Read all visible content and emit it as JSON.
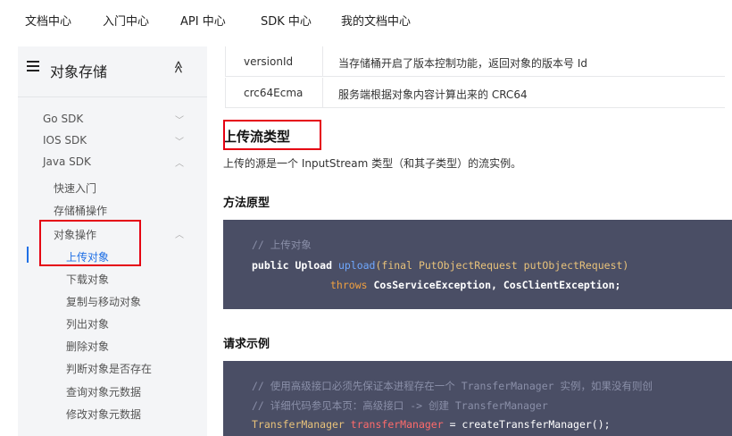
{
  "topnav": [
    "文档中心",
    "入门中心",
    "API 中心",
    "SDK 中心",
    "我的文档中心"
  ],
  "sidebar": {
    "title": "对象存储",
    "collapse_glyph": "≪",
    "items": [
      {
        "label": "Go SDK",
        "chev": "﹀"
      },
      {
        "label": "IOS SDK",
        "chev": "﹀"
      },
      {
        "label": "Java SDK",
        "chev": "︿"
      },
      {
        "label": "快速入门"
      },
      {
        "label": "存储桶操作"
      },
      {
        "label": "对象操作",
        "chev": "︿"
      },
      {
        "label": "上传对象"
      },
      {
        "label": "下载对象"
      },
      {
        "label": "复制与移动对象"
      },
      {
        "label": "列出对象"
      },
      {
        "label": "删除对象"
      },
      {
        "label": "判断对象是否存在"
      },
      {
        "label": "查询对象元数据"
      },
      {
        "label": "修改对象元数据"
      }
    ],
    "active_color": "#1f6fe5"
  },
  "table": {
    "rows": [
      {
        "name": "versionId",
        "desc": "当存储桶开启了版本控制功能，返回对象的版本号 Id"
      },
      {
        "name": "crc64Ecma",
        "desc": "服务端根据对象内容计算出来的 CRC64"
      }
    ]
  },
  "main": {
    "section_title": "上传流类型",
    "section_desc": "上传的源是一个 InputStream 类型（和其子类型）的流实例。",
    "proto_title": "方法原型",
    "proto_code": {
      "comment": "// 上传对象",
      "l2_kw": "public ",
      "l2_type": "Upload ",
      "l2_fn": "upload",
      "l2_rest": "(final PutObjectRequest putObjectRequest)",
      "l3_kw": "throws ",
      "l3_rest": "CosServiceException, CosClientException;"
    },
    "example_title": "请求示例",
    "example_code": {
      "c1": "// 使用高级接口必须先保证本进程存在一个 TransferManager 实例，如果没有则创",
      "c2": "// 详细代码参见本页：高级接口 -> 创建 TransferManager",
      "l3_type": "TransferManager ",
      "l3_var": "transferManager",
      "l3_rest": " = createTransferManager();"
    }
  },
  "colors": {
    "highlight": "#e50012",
    "code_bg": "#4a4e65"
  }
}
